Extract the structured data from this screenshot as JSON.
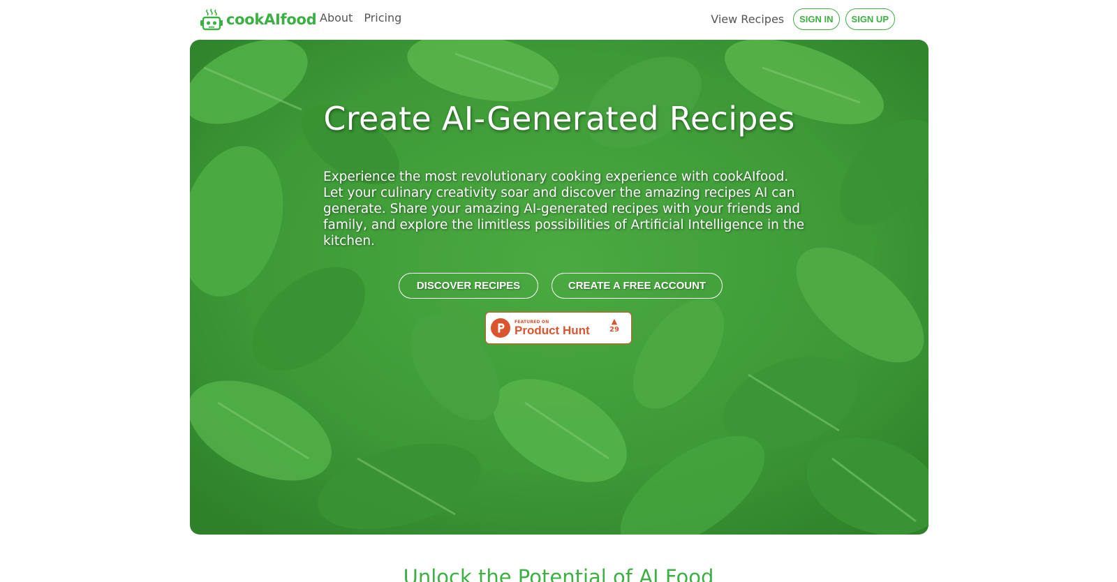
{
  "nav": {
    "brand_name": "cookAIfood",
    "links_left": [
      "About",
      "Pricing"
    ],
    "view_recipes": "View Recipes",
    "sign_in": "SIGN IN",
    "sign_up": "SIGN UP"
  },
  "hero": {
    "title": "Create AI-Generated Recipes",
    "description": "Experience the most revolutionary cooking experience with cookAIfood. Let your culinary creativity soar and discover the amazing recipes AI can generate. Share your amazing AI-generated recipes with your friends and family, and explore the limitless possibilities of Artificial Intelligence in the kitchen.",
    "discover_button": "DISCOVER RECIPES",
    "create_account_button": "CREATE A FREE ACCOUNT"
  },
  "product_hunt": {
    "featured_label": "FEATURED ON",
    "name": "Product Hunt",
    "upvote_icon": "triangle-up-icon",
    "votes": "29"
  },
  "section": {
    "title": "Unlock the Potential of AI Food"
  },
  "colors": {
    "brand_green": "#3cb043",
    "hero_green": "#3f9e3a",
    "product_hunt_orange": "#da552f"
  }
}
